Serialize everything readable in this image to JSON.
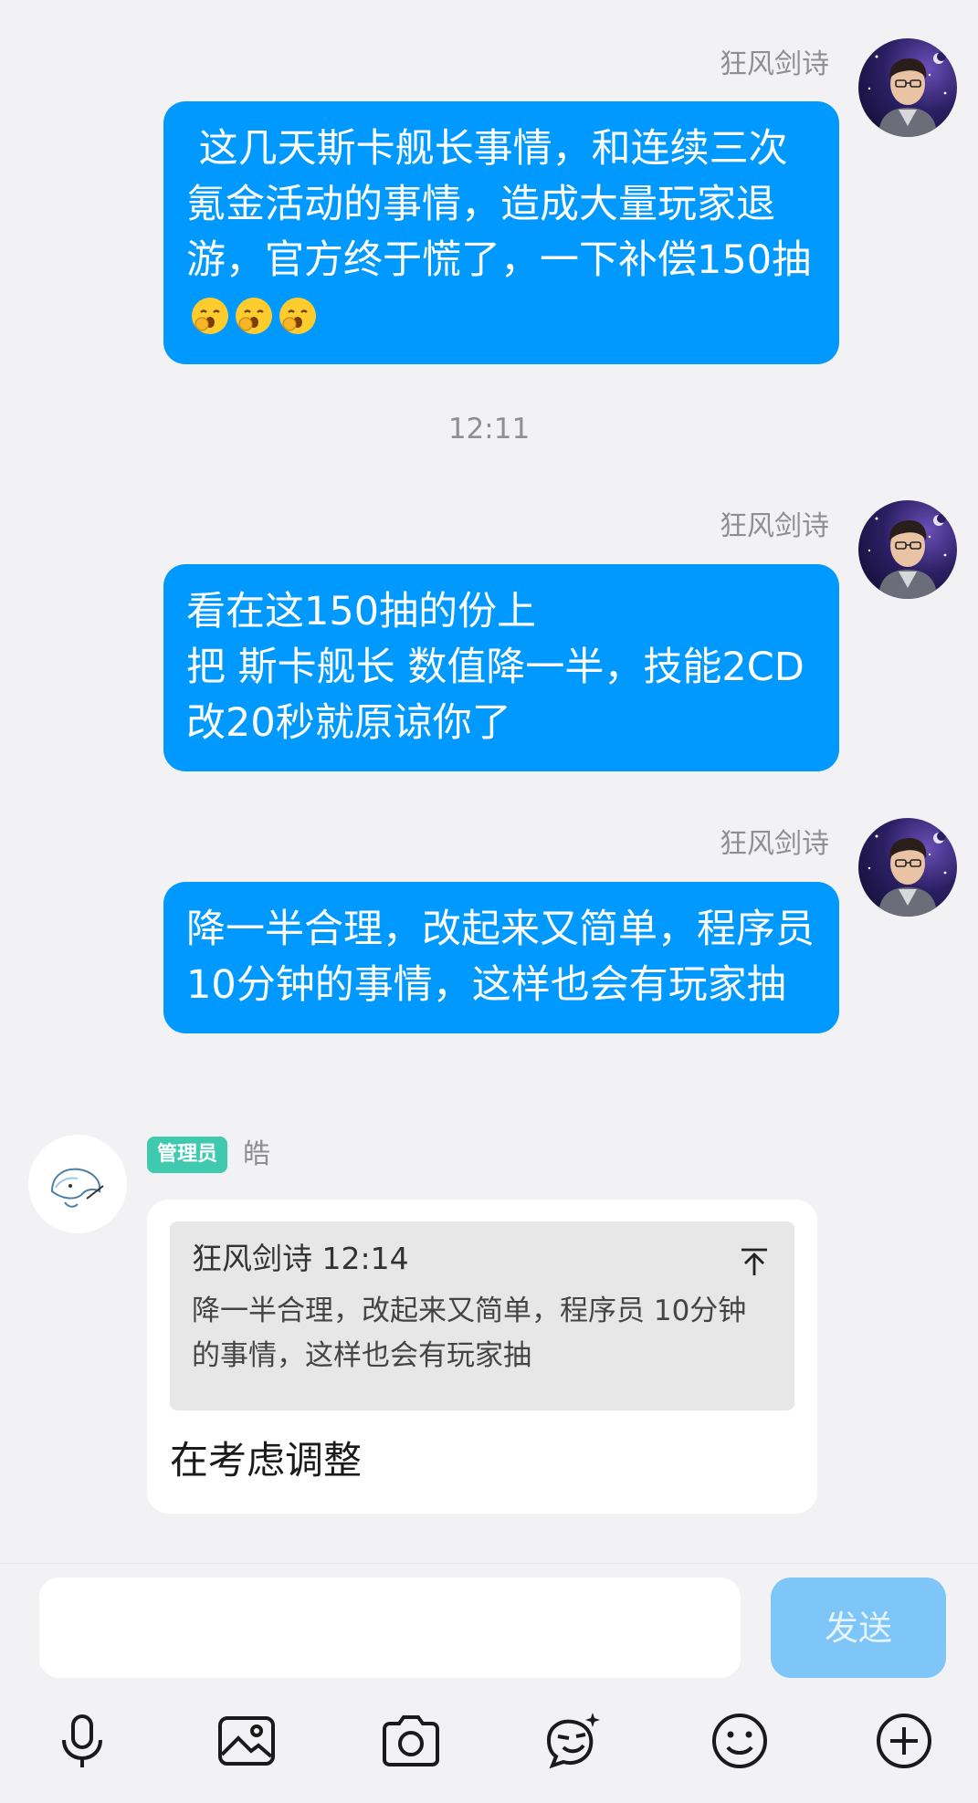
{
  "messages": [
    {
      "sender": "狂风剑诗",
      "text": " 这几天斯卡舰长事情，和连续三次氪金活动的事情，造成大量玩家退游，官方终于慌了，一下补偿150抽",
      "emoji": [
        "yawn-emoji",
        "yawn-emoji",
        "yawn-emoji"
      ]
    },
    {
      "sender": "狂风剑诗",
      "text": "看在这150抽的份上\n把 斯卡舰长 数值降一半，技能2CD改20秒就原谅你了"
    },
    {
      "sender": "狂风剑诗",
      "text": "降一半合理，改起来又简单，程序员 10分钟的事情，这样也会有玩家抽"
    }
  ],
  "timestamp": "12:11",
  "admin_reply": {
    "role_badge": "管理员",
    "name": "皓",
    "quote": {
      "header": "狂风剑诗 12:14",
      "text": "降一半合理，改起来又简单，程序员 10分钟的事情，这样也会有玩家抽"
    },
    "text": "在考虑调整"
  },
  "input_bar": {
    "placeholder": "",
    "send_label": "发送",
    "tools": [
      "microphone-icon",
      "image-icon",
      "camera-icon",
      "sticker-icon",
      "emoji-icon",
      "plus-icon"
    ]
  },
  "colors": {
    "self_bubble": "#0099ff",
    "admin_badge": "#3fcab0",
    "send_button": "#7fc6f8",
    "background": "#f2f2f4"
  }
}
